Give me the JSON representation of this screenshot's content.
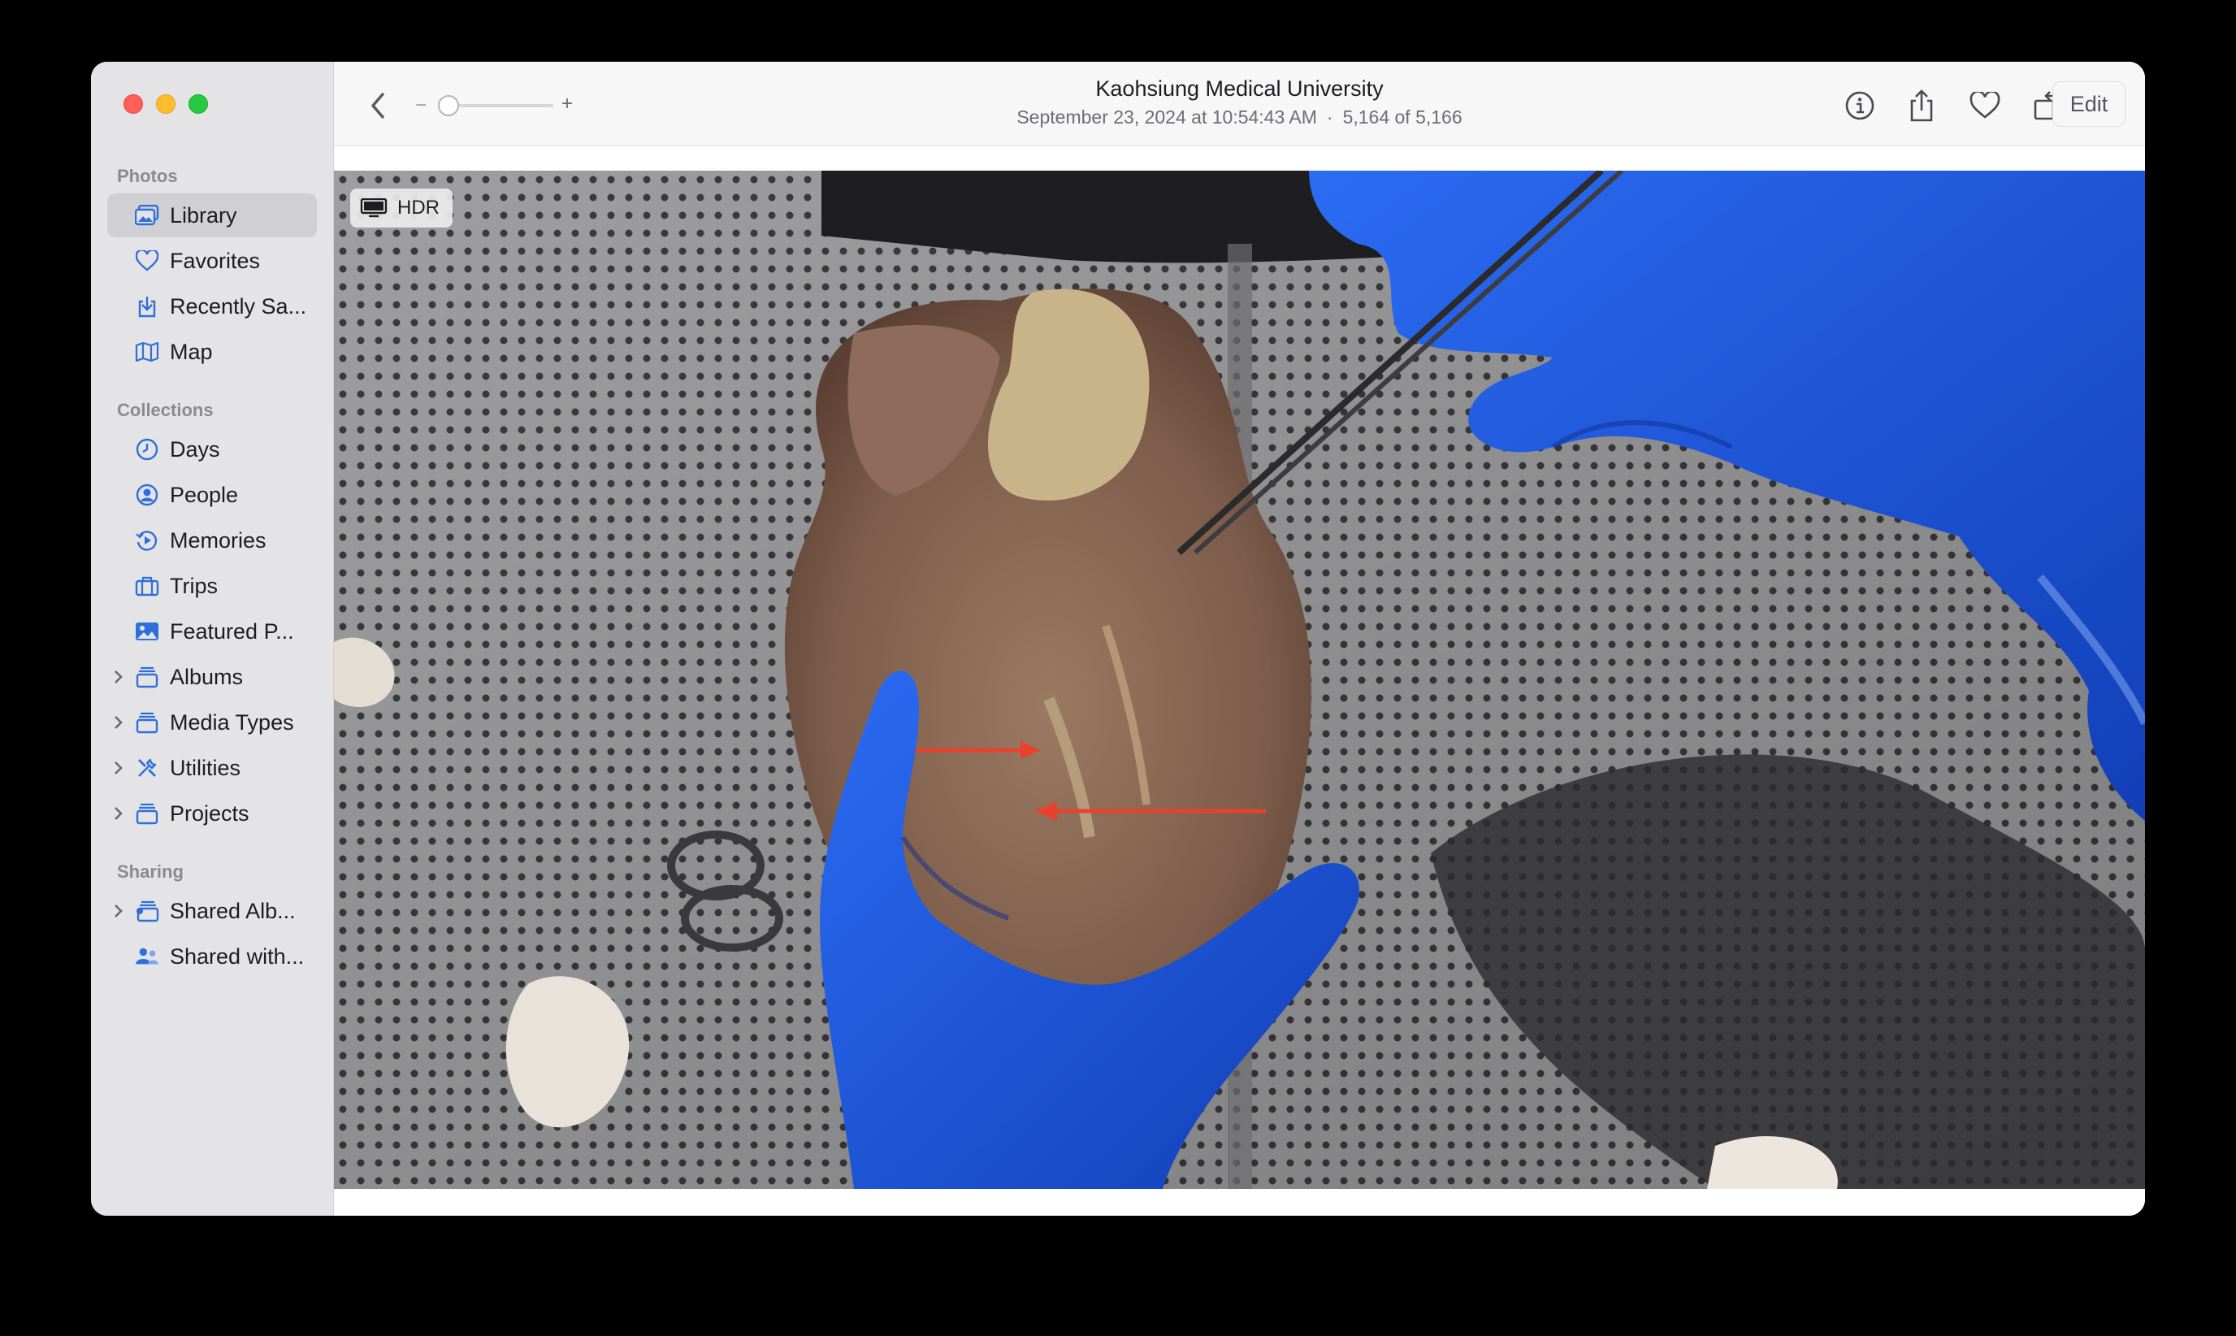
{
  "window": {
    "title": "Kaohsiung Medical University",
    "date": "September 23, 2024 at 10:54:43 AM",
    "separator": "·",
    "position": "5,164 of 5,166"
  },
  "toolbar": {
    "zoom_minus": "−",
    "zoom_plus": "+",
    "edit_label": "Edit",
    "icons": [
      "chevron-left-icon",
      "info-icon",
      "share-icon",
      "heart-icon",
      "rotate-icon",
      "magic-wand-icon"
    ]
  },
  "sidebar": {
    "sections": [
      {
        "title": "Photos"
      },
      {
        "title": "Collections"
      },
      {
        "title": "Sharing"
      }
    ],
    "items": [
      {
        "label": "Library",
        "icon": "library-icon",
        "selected": true
      },
      {
        "label": "Favorites",
        "icon": "heart-icon"
      },
      {
        "label": "Recently Sa...",
        "icon": "recently-saved-icon"
      },
      {
        "label": "Map",
        "icon": "map-icon"
      },
      {
        "label": "Days",
        "icon": "clock-icon"
      },
      {
        "label": "People",
        "icon": "person-icon"
      },
      {
        "label": "Memories",
        "icon": "memories-icon"
      },
      {
        "label": "Trips",
        "icon": "suitcase-icon"
      },
      {
        "label": "Featured P...",
        "icon": "photo-icon"
      },
      {
        "label": "Albums",
        "icon": "album-icon",
        "disclosure": true
      },
      {
        "label": "Media Types",
        "icon": "album-icon",
        "disclosure": true
      },
      {
        "label": "Utilities",
        "icon": "tools-icon",
        "disclosure": true
      },
      {
        "label": "Projects",
        "icon": "album-icon",
        "disclosure": true
      },
      {
        "label": "Shared Alb...",
        "icon": "shared-album-icon",
        "disclosure": true
      },
      {
        "label": "Shared with...",
        "icon": "shared-people-icon"
      }
    ]
  },
  "photo": {
    "badge": "HDR"
  },
  "colors": {
    "accent": "#2f6fdb",
    "sidebar_bg": "#e4e4e6",
    "selection": "#d0d0d4",
    "glove_blue": "#1b55e0",
    "arrow_red": "#e8422f"
  }
}
